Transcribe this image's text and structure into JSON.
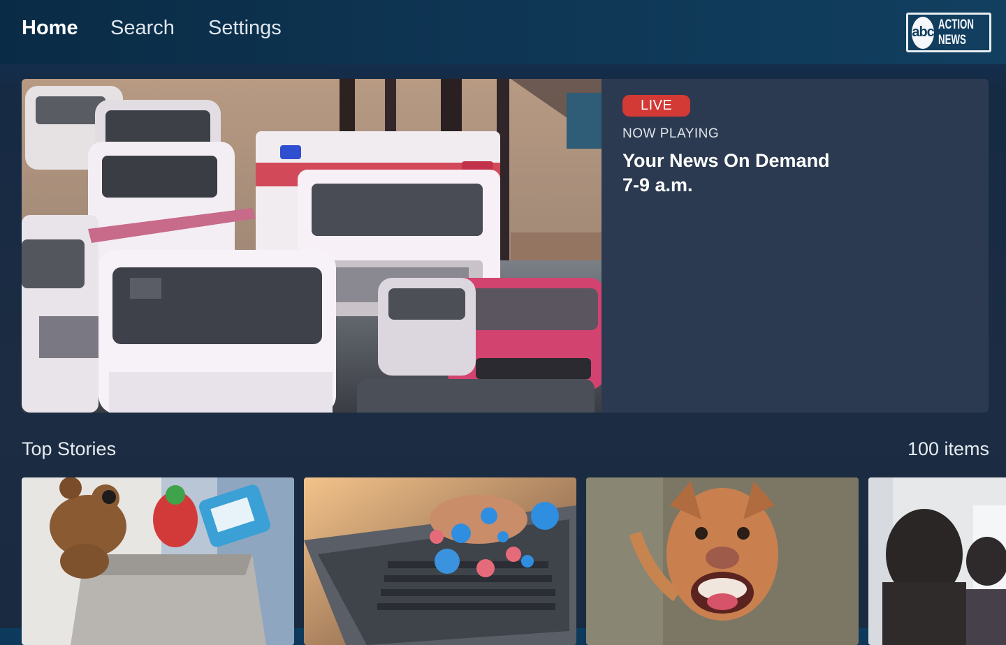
{
  "nav": {
    "home": "Home",
    "search": "Search",
    "settings": "Settings"
  },
  "logo": {
    "abc": "abc",
    "line1": "ACTION",
    "line2": "NEWS"
  },
  "hero": {
    "badge": "LIVE",
    "now_playing": "NOW PLAYING",
    "title": "Your News On Demand 7-9 a.m."
  },
  "section": {
    "title": "Top Stories",
    "count": "100 items"
  },
  "colors": {
    "live_red": "#d33a35",
    "panel": "#2b3a50",
    "nav_bg": "#0e3654"
  }
}
